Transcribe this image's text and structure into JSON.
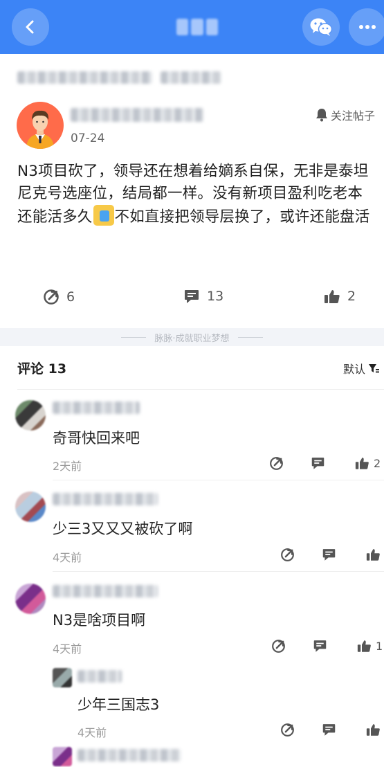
{
  "header": {
    "back_icon": "chevron-left-icon",
    "wechat_icon": "wechat-icon",
    "more_icon": "more-icon"
  },
  "post": {
    "date": "07-24",
    "follow_label": "关注帖子",
    "text_part1": "N3项目砍了，领导还在想着给嫡系自保，无非是泰坦尼克号选座位，结局都一样。没有新项目盈利吃老本还能活多久",
    "text_part2": "不如直接把领导层换了，或许还能盘活",
    "stats": {
      "shares": "6",
      "comments": "13",
      "likes": "2"
    }
  },
  "divider_text": "脉脉·成就职业梦想",
  "comments_section": {
    "title": "评论 13",
    "sort_label": "默认"
  },
  "comments": [
    {
      "text": "奇哥快回来吧",
      "time": "2天前",
      "likes": "2"
    },
    {
      "text": "少三3又又又被砍了啊",
      "time": "4天前",
      "likes": ""
    },
    {
      "text": "N3是啥项目啊",
      "time": "4天前",
      "likes": "1"
    }
  ],
  "reply": {
    "text": "少年三国志3",
    "time": "4天前"
  },
  "colors": {
    "header_blue": "#3c84f6",
    "avatar_orange": "#ff6b4a"
  }
}
